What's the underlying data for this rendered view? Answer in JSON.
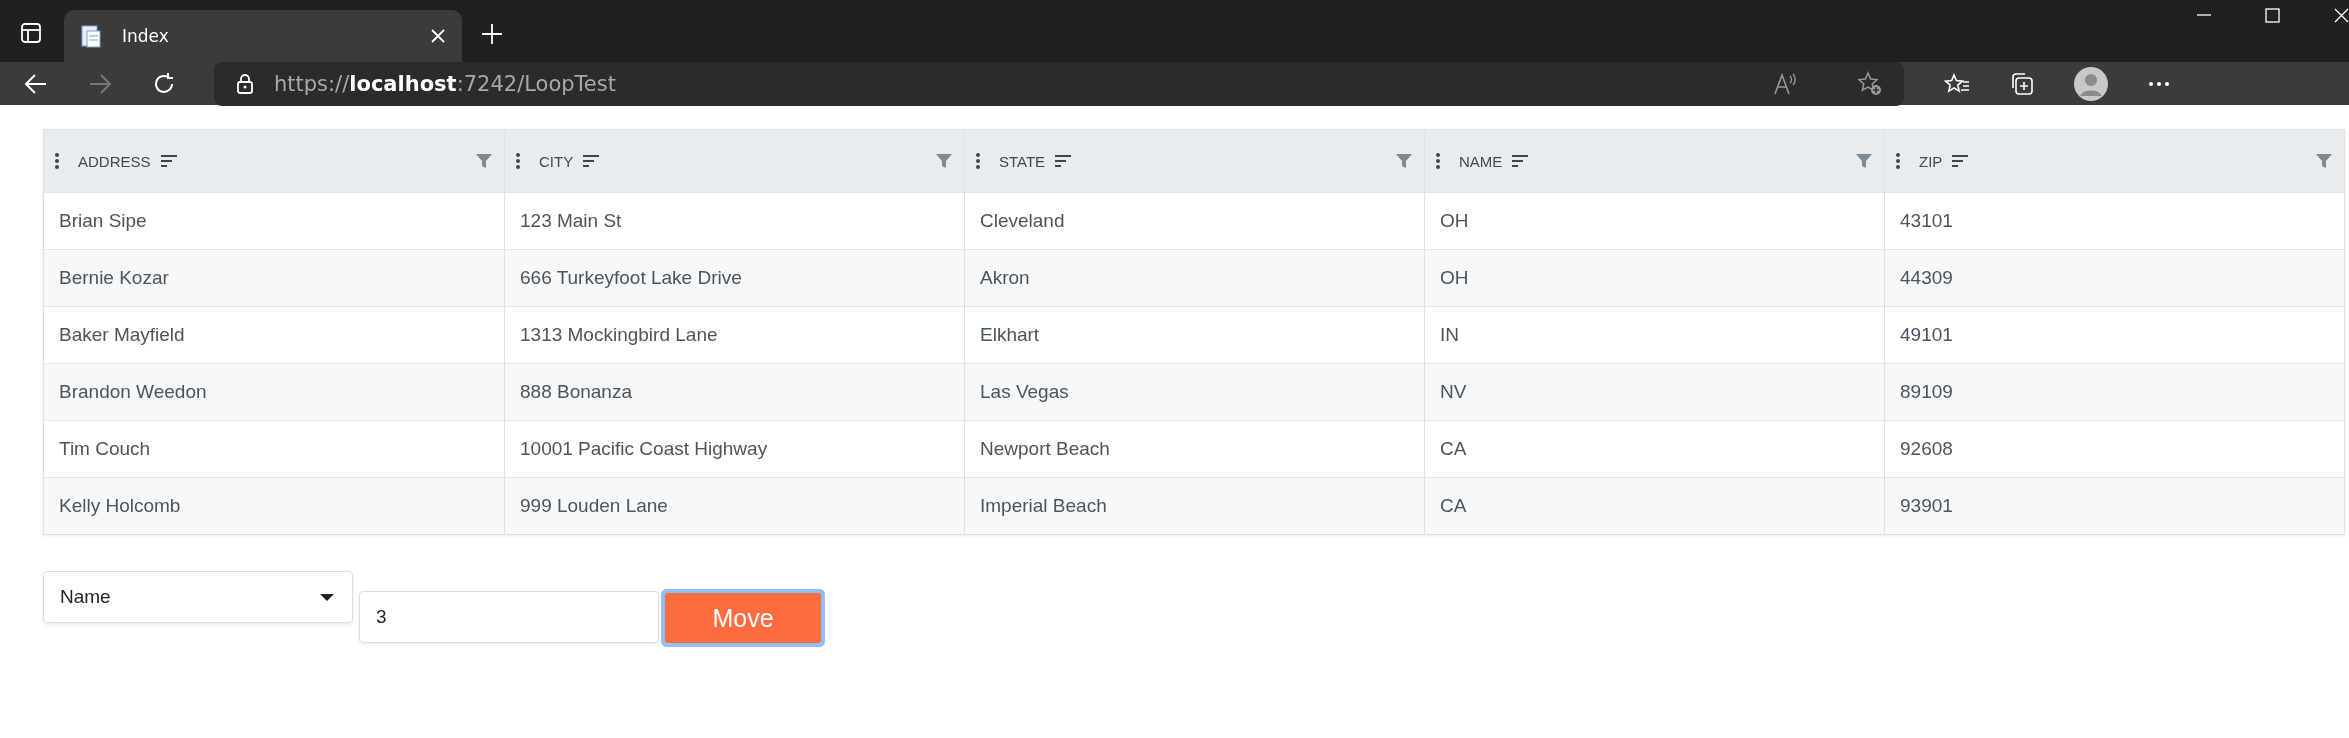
{
  "browser": {
    "tab": {
      "title": "Index",
      "selected": true
    },
    "address": "https://**localhost**:7242/LoopTest"
  },
  "table": {
    "columns": [
      {
        "label": "ADDRESS"
      },
      {
        "label": "CITY"
      },
      {
        "label": "STATE"
      },
      {
        "label": "NAME"
      },
      {
        "label": "ZIP"
      }
    ],
    "rows": [
      [
        "Brian Sipe",
        "123 Main St",
        "Cleveland",
        "OH",
        "43101"
      ],
      [
        "Bernie Kozar",
        "666 Turkeyfoot Lake Drive",
        "Akron",
        "OH",
        "44309"
      ],
      [
        "Baker Mayfield",
        "1313 Mockingbird Lane",
        "Elkhart",
        "IN",
        "49101"
      ],
      [
        "Brandon Weedon",
        "888 Bonanza",
        "Las Vegas",
        "NV",
        "89109"
      ],
      [
        "Tim Couch",
        "10001 Pacific Coast Highway",
        "Newport Beach",
        "CA",
        "92608"
      ],
      [
        "Kelly Holcomb",
        "999 Louden Lane",
        "Imperial Beach",
        "CA",
        "93901"
      ]
    ]
  },
  "form": {
    "dropdown": {
      "value": "Name"
    },
    "input": {
      "value": "3"
    },
    "button": {
      "label": "Move",
      "focused": true
    }
  }
}
